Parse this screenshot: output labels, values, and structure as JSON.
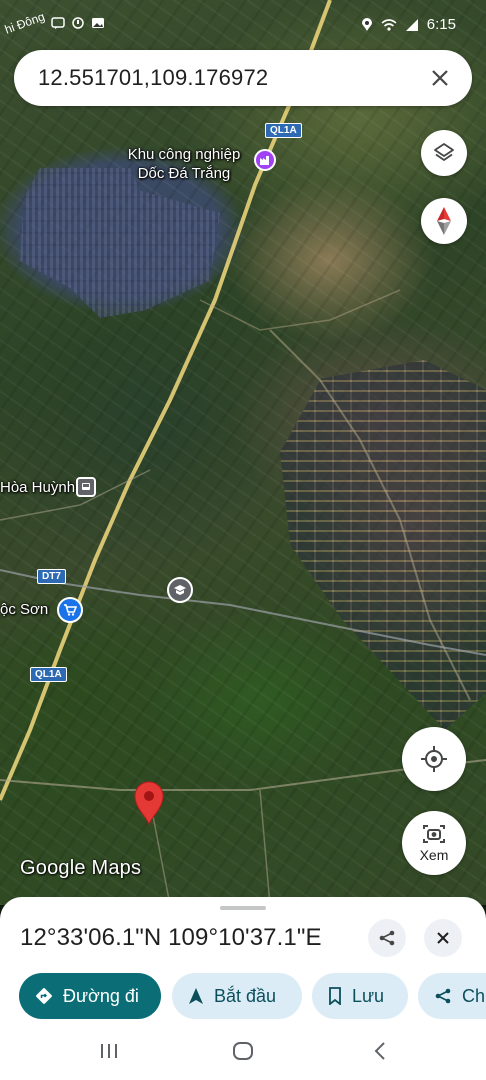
{
  "status_bar": {
    "left_fragment": "hi Đông",
    "time": "6:15"
  },
  "search": {
    "query": "12.551701,109.176972"
  },
  "map": {
    "labels": {
      "industrial_zone": [
        "Khu công nghiệp",
        "Dốc Đá Trắng"
      ],
      "hoa_huynh": "Hòa Huỳnh",
      "loc_son": "ộc Sơn"
    },
    "road_shields": {
      "ql1a_top": "QL1A",
      "dt7": "DT7",
      "ql1a_bottom": "QL1A"
    },
    "logo": {
      "google": "Google",
      "maps": "Maps"
    },
    "controls": {
      "xem_label": "Xem"
    },
    "colors": {
      "pin": "#e53935",
      "poi_industrial": "#a142f4",
      "poi_shop": "#1a73e8",
      "poi_school": "#5f6368",
      "road": "#e8d27a"
    }
  },
  "place_sheet": {
    "coordinates": "12°33'06.1\"N 109°10'37.1\"E",
    "actions": {
      "directions": "Đường đi",
      "start": "Bắt đầu",
      "save": "Lưu",
      "share": "Ch"
    }
  }
}
